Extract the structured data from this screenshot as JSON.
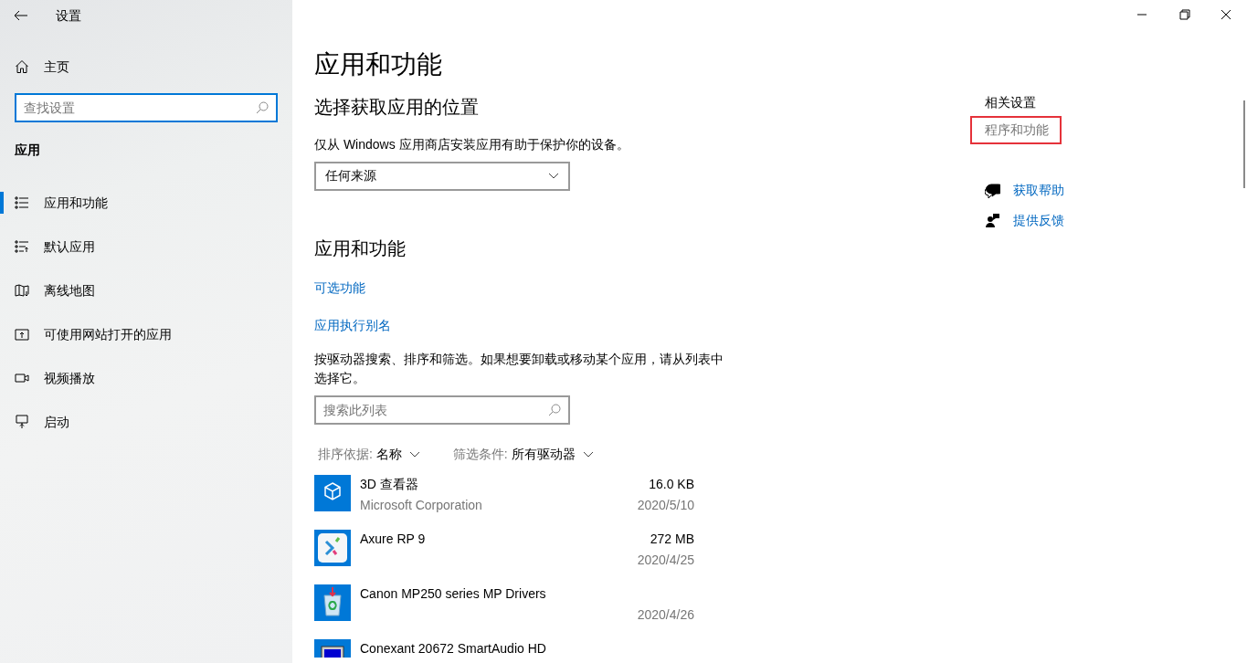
{
  "window": {
    "title": "设置"
  },
  "sidebar": {
    "home": "主页",
    "search_placeholder": "查找设置",
    "section": "应用",
    "items": [
      {
        "label": "应用和功能",
        "selected": true
      },
      {
        "label": "默认应用",
        "selected": false
      },
      {
        "label": "离线地图",
        "selected": false
      },
      {
        "label": "可使用网站打开的应用",
        "selected": false
      },
      {
        "label": "视频播放",
        "selected": false
      },
      {
        "label": "启动",
        "selected": false
      }
    ]
  },
  "main": {
    "title": "应用和功能",
    "source_heading": "选择获取应用的位置",
    "source_description": "仅从 Windows 应用商店安装应用有助于保护你的设备。",
    "source_value": "任何来源",
    "apps_heading": "应用和功能",
    "links": [
      "可选功能",
      "应用执行别名"
    ],
    "apps_description": "按驱动器搜索、排序和筛选。如果想要卸载或移动某个应用，请从列表中选择它。",
    "search_placeholder": "搜索此列表",
    "sort_label": "排序依据:",
    "sort_value": "名称",
    "filter_label": "筛选条件:",
    "filter_value": "所有驱动器",
    "apps": [
      {
        "name": "3D 查看器",
        "publisher": "Microsoft Corporation",
        "size": "16.0 KB",
        "date": "2020/5/10"
      },
      {
        "name": "Axure RP 9",
        "size": "272 MB",
        "date": "2020/4/25"
      },
      {
        "name": "Canon MP250 series MP Drivers",
        "date": "2020/4/26"
      },
      {
        "name": "Conexant 20672 SmartAudio HD"
      }
    ]
  },
  "related": {
    "heading": "相关设置",
    "links": [
      {
        "label": "程序和功能",
        "highlighted": true
      }
    ],
    "help": [
      {
        "kind": "help",
        "label": "获取帮助"
      },
      {
        "kind": "feedback",
        "label": "提供反馈"
      }
    ]
  }
}
